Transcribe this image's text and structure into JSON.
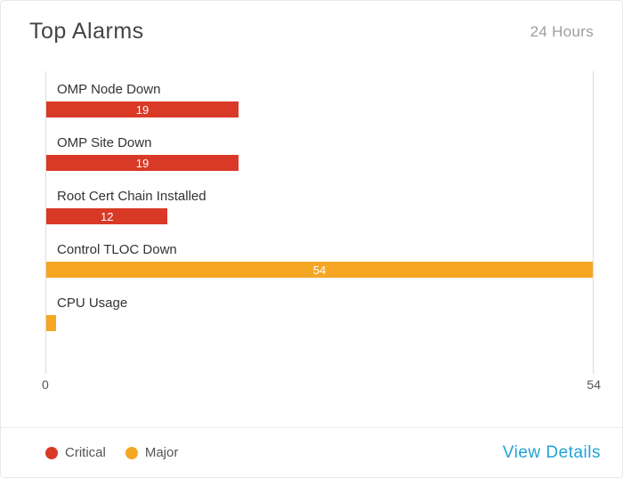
{
  "header": {
    "title": "Top Alarms",
    "period": "24 Hours"
  },
  "chart_data": {
    "type": "bar",
    "orientation": "horizontal",
    "xlim": [
      0,
      54
    ],
    "x_ticks": {
      "min": "0",
      "max": "54"
    },
    "series_colors": {
      "Critical": "#d93927",
      "Major": "#f5a623"
    },
    "bars": [
      {
        "label": "OMP Node Down",
        "value": 19,
        "series": "Critical"
      },
      {
        "label": "OMP Site Down",
        "value": 19,
        "series": "Critical"
      },
      {
        "label": "Root Cert Chain Installed",
        "value": 12,
        "series": "Critical"
      },
      {
        "label": "Control TLOC Down",
        "value": 54,
        "series": "Major"
      },
      {
        "label": "CPU Usage",
        "value": 1,
        "series": "Major"
      }
    ]
  },
  "legend": {
    "critical": "Critical",
    "major": "Major"
  },
  "footer": {
    "view_details": "View Details"
  }
}
